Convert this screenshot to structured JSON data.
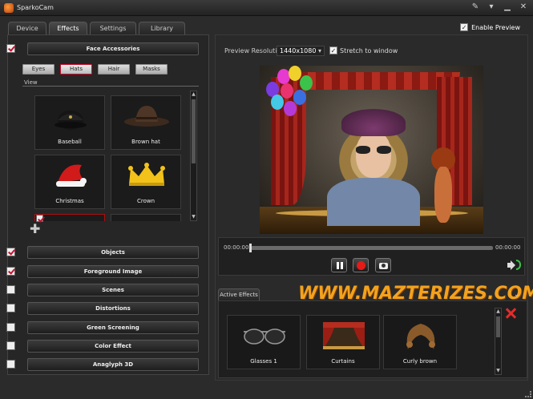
{
  "window": {
    "title": "SparkoCam"
  },
  "tabs": [
    "Device",
    "Effects",
    "Settings",
    "Library"
  ],
  "enable_preview": {
    "label": "Enable Preview",
    "checked": true
  },
  "left": {
    "face_accessories": {
      "label": "Face Accessories",
      "checked": true
    },
    "subtabs": [
      "Eyes",
      "Hats",
      "Hair",
      "Masks"
    ],
    "active_subtab": "Hats",
    "view_label": "View",
    "tiles": [
      "Baseball",
      "Brown hat",
      "Christmas",
      "Crown"
    ],
    "sections": [
      {
        "label": "Objects",
        "checked": true
      },
      {
        "label": "Foreground Image",
        "checked": true
      },
      {
        "label": "Scenes",
        "checked": false
      },
      {
        "label": "Distortions",
        "checked": false
      },
      {
        "label": "Green Screening",
        "checked": false
      },
      {
        "label": "Color Effect",
        "checked": false
      },
      {
        "label": "Anaglyph 3D",
        "checked": false
      }
    ]
  },
  "preview": {
    "resolution_label": "Preview Resolution:",
    "resolution_value": "1440x1080",
    "stretch_label": "Stretch to window",
    "stretch_checked": true
  },
  "player": {
    "time_start": "00:00:00",
    "time_end": "00:00:00"
  },
  "watermark": "WWW.MAZTERIZES.COM",
  "active_effects": {
    "tab_label": "Active Effects",
    "items": [
      "Glasses 1",
      "Curtains",
      "Curly brown"
    ]
  },
  "colors": {
    "accent": "#c8102e",
    "record": "#e41b17",
    "watermark": "#f3a21e"
  }
}
